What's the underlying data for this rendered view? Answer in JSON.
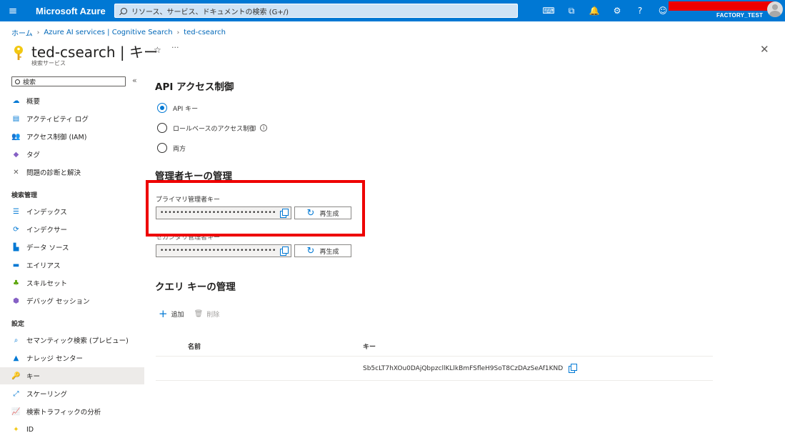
{
  "topbar": {
    "menu_icon": "hamburger-icon",
    "brand": "Microsoft Azure",
    "search_placeholder": "リソース、サービス、ドキュメントの検索 (G+/)",
    "icons": [
      "cloud-shell-icon",
      "directory-filter-icon",
      "bell-icon",
      "gear-icon",
      "help-icon",
      "feedback-icon"
    ],
    "tenant": "FACTORY_TEST"
  },
  "breadcrumb": {
    "items": [
      "ホーム",
      "Azure AI services | Cognitive Search",
      "ted-csearch"
    ]
  },
  "page": {
    "title": "ted-csearch | キー",
    "subtitle": "検索サービス",
    "favorite_icon": "☆",
    "more_icon": "···",
    "close_icon": "✕"
  },
  "sidebar": {
    "search_placeholder": "検索",
    "collapse_icon": "«",
    "items": [
      {
        "label": "概要",
        "icon": "cloud-icon",
        "glyph": "☁",
        "color": "#0078d4"
      },
      {
        "label": "アクティビティ ログ",
        "icon": "log-icon",
        "glyph": "▤",
        "color": "#0078d4"
      },
      {
        "label": "アクセス制御 (IAM)",
        "icon": "people-icon",
        "glyph": "👥",
        "color": "#0078d4"
      },
      {
        "label": "タグ",
        "icon": "tag-icon",
        "glyph": "◆",
        "color": "#8661c5"
      },
      {
        "label": "問題の診断と解決",
        "icon": "tools-icon",
        "glyph": "✕",
        "color": "#605e5c"
      }
    ],
    "section1": "検索管理",
    "items2": [
      {
        "label": "インデックス",
        "icon": "index-icon",
        "glyph": "☰",
        "color": "#0078d4"
      },
      {
        "label": "インデクサー",
        "icon": "indexer-icon",
        "glyph": "⟳",
        "color": "#0078d4"
      },
      {
        "label": "データ ソース",
        "icon": "datasource-icon",
        "glyph": "▙",
        "color": "#0078d4"
      },
      {
        "label": "エイリアス",
        "icon": "alias-icon",
        "glyph": "▬",
        "color": "#0078d4"
      },
      {
        "label": "スキルセット",
        "icon": "skillset-icon",
        "glyph": "♣",
        "color": "#57a300"
      },
      {
        "label": "デバッグ セッション",
        "icon": "debug-icon",
        "glyph": "⬢",
        "color": "#8661c5"
      }
    ],
    "section2": "設定",
    "items3": [
      {
        "label": "セマンティック検索 (プレビュー)",
        "icon": "search-icon",
        "glyph": "⌕",
        "color": "#0078d4"
      },
      {
        "label": "ナレッジ センター",
        "icon": "knowledge-icon",
        "glyph": "▲",
        "color": "#0078d4"
      },
      {
        "label": "キー",
        "icon": "key-icon",
        "glyph": "🔑",
        "color": "#f2c811"
      },
      {
        "label": "スケーリング",
        "icon": "scale-icon",
        "glyph": "⤢",
        "color": "#0078d4"
      },
      {
        "label": "検索トラフィックの分析",
        "icon": "chart-icon",
        "glyph": "📈",
        "color": "#323130"
      },
      {
        "label": "ID",
        "icon": "identity-icon",
        "glyph": "✦",
        "color": "#f2c811"
      }
    ]
  },
  "access": {
    "heading": "API アクセス制御",
    "options": [
      "API キー",
      "ロールベースのアクセス制御",
      "両方"
    ],
    "selected": 0
  },
  "admin_keys": {
    "heading": "管理者キーの管理",
    "primary_label": "プライマリ管理者キー",
    "secondary_label": "セカンダリ管理者キー",
    "masked": "••••••••••••••••••••••••••••••••••••••••••••••",
    "regen_label": "再生成"
  },
  "query_keys": {
    "heading": "クエリ キーの管理",
    "add_label": "追加",
    "delete_label": "削除",
    "columns": [
      "名前",
      "キー"
    ],
    "rows": [
      {
        "name": "",
        "key": "Sb5cLT7hXOu0DAjQbpzcllKLlkBmFSfleH9SoT8CzDAzSeAf1KND"
      }
    ]
  }
}
